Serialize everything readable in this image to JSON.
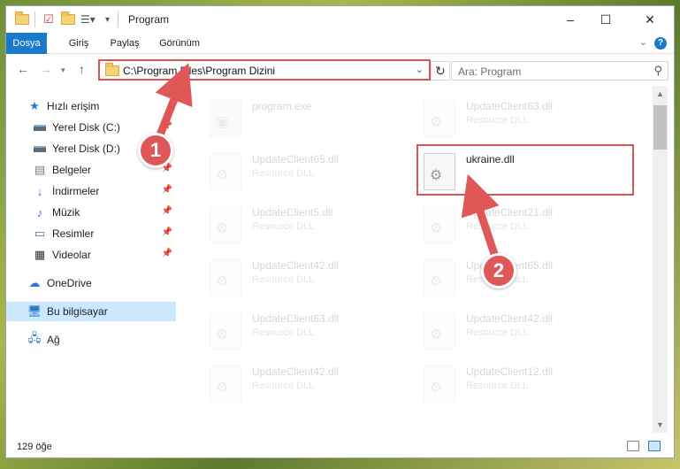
{
  "window": {
    "title": "Program",
    "controls": [
      "–",
      "☐",
      "✕"
    ]
  },
  "ribbon": {
    "tabs": [
      "Dosya",
      "Giriş",
      "Paylaş",
      "Görünüm"
    ],
    "help": "?"
  },
  "address": {
    "path": "C:\\Program Files\\Program Dizini",
    "search_placeholder": "Ara: Program"
  },
  "sidebar": {
    "items": [
      {
        "label": "Hızlı erişim",
        "icon": "star-icon",
        "pinned": false
      },
      {
        "label": "Yerel Disk (C:)",
        "icon": "drive-icon",
        "pinned": true
      },
      {
        "label": "Yerel Disk (D:)",
        "icon": "drive-icon",
        "pinned": true
      },
      {
        "label": "Belgeler",
        "icon": "documents-icon",
        "pinned": true
      },
      {
        "label": "İndirmeler",
        "icon": "downloads-icon",
        "pinned": true
      },
      {
        "label": "Müzik",
        "icon": "music-icon",
        "pinned": true
      },
      {
        "label": "Resimler",
        "icon": "pictures-icon",
        "pinned": true
      },
      {
        "label": "Videolar",
        "icon": "videos-icon",
        "pinned": true
      },
      {
        "label": "OneDrive",
        "icon": "cloud-icon",
        "pinned": false
      },
      {
        "label": "Bu bilgisayar",
        "icon": "computer-icon",
        "pinned": false,
        "selected": true
      },
      {
        "label": "Ağ",
        "icon": "network-icon",
        "pinned": false
      }
    ]
  },
  "files": [
    {
      "name": "program.exe",
      "type": "",
      "highlight": false
    },
    {
      "name": "UpdateClient63.dll",
      "type": "Resource DLL",
      "highlight": false
    },
    {
      "name": "UpdateClient65.dll",
      "type": "Resource DLL",
      "highlight": false
    },
    {
      "name": "ukraine.dll",
      "type": "",
      "highlight": true
    },
    {
      "name": "UpdateClient5.dll",
      "type": "Resource DLL",
      "highlight": false
    },
    {
      "name": "UpdateClient21.dll",
      "type": "Resource DLL",
      "highlight": false
    },
    {
      "name": "UpdateClient42.dll",
      "type": "Resource DLL",
      "highlight": false
    },
    {
      "name": "UpdateClient65.dll",
      "type": "Resource DLL",
      "highlight": false
    },
    {
      "name": "UpdateClient63.dll",
      "type": "Resource DLL",
      "highlight": false
    },
    {
      "name": "UpdateClient42.dll",
      "type": "Resource DLL",
      "highlight": false
    },
    {
      "name": "UpdateClient42.dll",
      "type": "Resource DLL",
      "highlight": false
    },
    {
      "name": "UpdateClient12.dll",
      "type": "Resource DLL",
      "highlight": false
    }
  ],
  "status": {
    "count": "129 öğe"
  },
  "annotations": {
    "badge1": "1",
    "badge2": "2",
    "accent": "#e05757"
  }
}
